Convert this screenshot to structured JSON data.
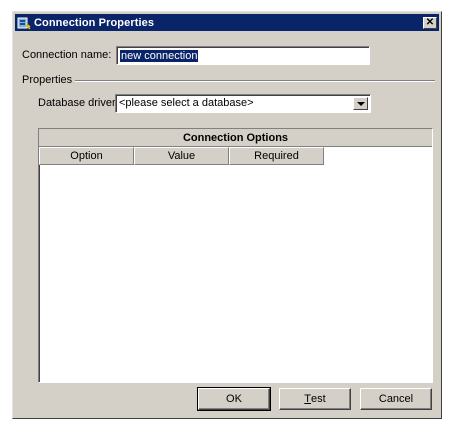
{
  "window": {
    "title": "Connection Properties",
    "close_glyph": "✕",
    "icon": "connection-app-icon"
  },
  "connection_name": {
    "label": "Connection name:",
    "value": "new connection"
  },
  "properties": {
    "group_label": "Properties",
    "driver_label": "Database driver:",
    "driver_value": "<please select a database>"
  },
  "options_table": {
    "title": "Connection Options",
    "columns": [
      "Option",
      "Value",
      "Required"
    ],
    "rows": []
  },
  "buttons": {
    "ok": "OK",
    "test_first": "T",
    "test_rest": "est",
    "cancel": "Cancel"
  },
  "colors": {
    "titlebar": "#0a246a",
    "face": "#d4d0c8",
    "selection": "#0a246a"
  }
}
